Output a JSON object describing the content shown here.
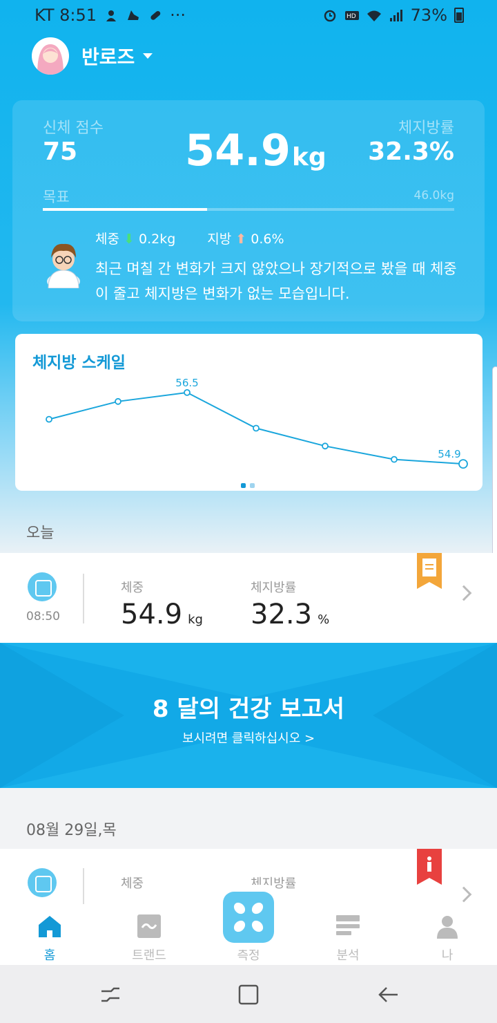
{
  "status_bar": {
    "carrier_time": "KT 8:51",
    "dots": "···",
    "battery": "73%"
  },
  "profile": {
    "name": "반로즈"
  },
  "summary": {
    "body_score_label": "신체 점수",
    "body_score": "75",
    "weight_value": "54.9",
    "weight_unit": "kg",
    "body_fat_label": "체지방률",
    "body_fat": "32.3%",
    "goal_label": "목표",
    "goal_value": "46.0kg",
    "goal_progress": 0.4,
    "weight_change_label": "체중",
    "weight_change": "0.2kg",
    "fat_change_label": "지방",
    "fat_change": "0.6%",
    "message": "최근 며칠 간 변화가 크지 않았으나 장기적으로 봤을 때 체중이 줄고 체지방은 변화가 없는 모습입니다."
  },
  "chart_data": {
    "type": "line",
    "title": "체지방 스케일",
    "x": [
      1,
      2,
      3,
      4,
      5,
      6,
      7
    ],
    "values": [
      55.9,
      56.3,
      56.5,
      55.7,
      55.3,
      55.0,
      54.9
    ],
    "labeled_points": {
      "max": "56.5",
      "last": "54.9"
    },
    "ylim": [
      54.7,
      56.7
    ],
    "color": "#1aa6dc"
  },
  "today": {
    "section_label": "오늘",
    "time": "08:50",
    "weight_label": "체중",
    "weight": "54.9",
    "weight_unit": "kg",
    "fat_label": "체지방률",
    "fat": "32.3",
    "fat_unit": "%"
  },
  "banner": {
    "title": "8 달의 건강 보고서",
    "subtitle": "보시려면 클릭하십시오 >"
  },
  "previous": {
    "date_label": "08월 29일,목",
    "weight_label": "체중",
    "fat_label": "체지방률"
  },
  "bottom_nav": {
    "home": "홈",
    "trend": "트랜드",
    "measure": "측정",
    "analysis": "분석",
    "me": "나"
  },
  "colors": {
    "accent": "#1399d6",
    "banner": "#12a9e7"
  }
}
